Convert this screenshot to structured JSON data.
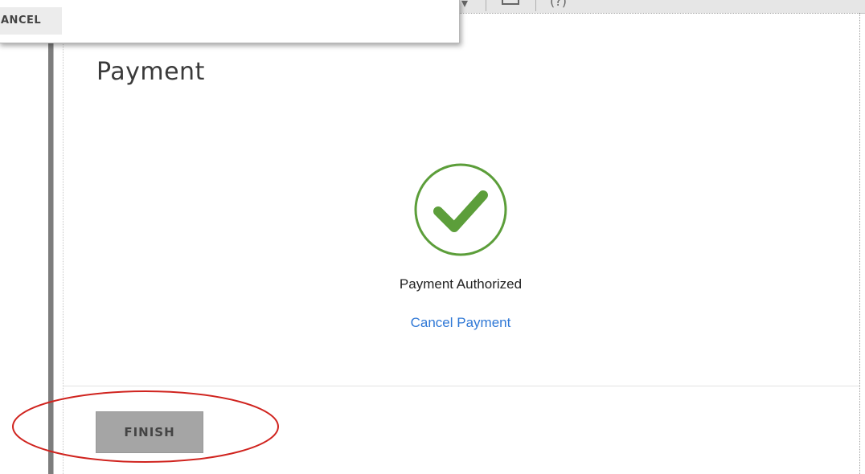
{
  "popup": {
    "cancel_label": "ANCEL"
  },
  "toolbar": {
    "icons": [
      "dropdown-arrow-icon",
      "printer-icon",
      "help-icon"
    ]
  },
  "dialog": {
    "title": "Payment",
    "status": "Payment Authorized",
    "cancel_link": "Cancel Payment",
    "finish_label": "FINISH"
  },
  "colors": {
    "success_green": "#5c9e3a",
    "link_blue": "#2f78d6",
    "finish_bg": "#a5a5a5",
    "annotation_red": "#d0241f"
  }
}
